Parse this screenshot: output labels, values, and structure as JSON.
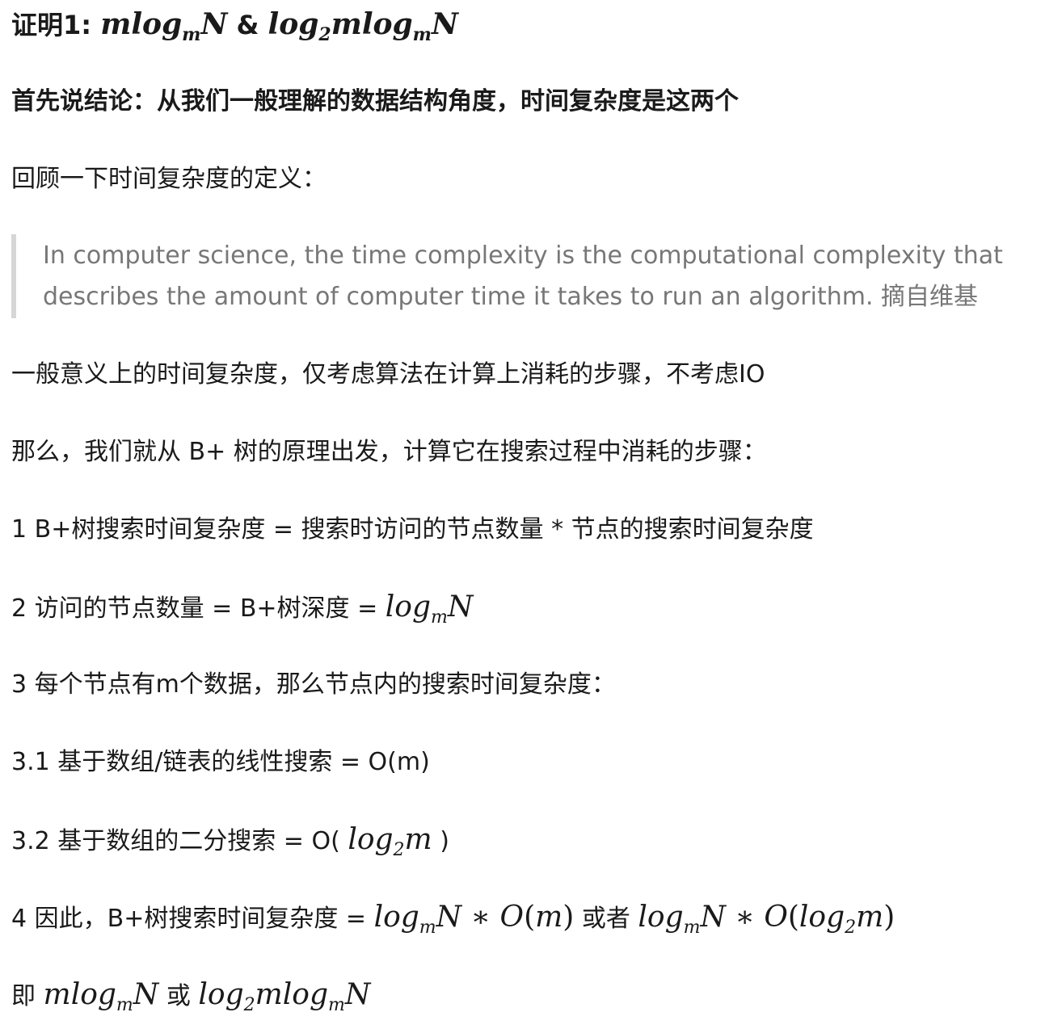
{
  "heading": {
    "prefix": "证明1:",
    "amp": "&"
  },
  "conclusion": "首先说结论：从我们一般理解的数据结构角度，时间复杂度是这两个",
  "recall": "回顾一下时间复杂度的定义：",
  "quote": {
    "line1": "In computer science, the time complexity is the computational complexity that",
    "line2": "describes the amount of computer time it takes to run an algorithm. 摘自维基"
  },
  "general_meaning": "一般意义上的时间复杂度，仅考虑算法在计算上消耗的步骤，不考虑IO",
  "then_text": "那么，我们就从 B+ 树的原理出发，计算它在搜索过程中消耗的步骤：",
  "step1": "1 B+树搜索时间复杂度 = 搜索时访问的节点数量 * 节点的搜索时间复杂度",
  "step2_prefix": "2 访问的节点数量 = B+树深度 = ",
  "step3": "3 每个节点有m个数据，那么节点内的搜索时间复杂度：",
  "step31": "3.1 基于数组/链表的线性搜索 = O(m)",
  "step32": {
    "prefix": "3.2 基于数组的二分搜索 = O( ",
    "suffix": " )"
  },
  "step4": {
    "prefix": "4 因此，B+树搜索时间复杂度 = ",
    "or": " 或者 "
  },
  "final": {
    "prefix": "即 ",
    "or": " 或 "
  },
  "math": {
    "log": "log",
    "sub_m": "m",
    "sub_2": "2",
    "var_m": "m",
    "var_N": "N",
    "star": "∗",
    "O": "O",
    "lparen": "(",
    "rparen": ")"
  }
}
